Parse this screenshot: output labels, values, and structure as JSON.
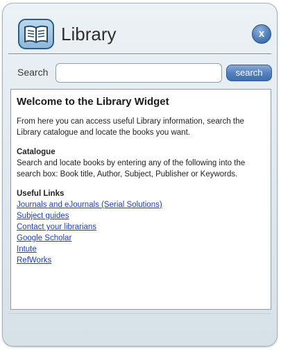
{
  "header": {
    "title": "Library",
    "app_icon": "open-book-icon",
    "close_label": "x"
  },
  "search": {
    "label": "Search",
    "value": "",
    "placeholder": "",
    "button_label": "search"
  },
  "content": {
    "heading": "Welcome to the Library Widget",
    "intro": "From here you can access useful Library information, search the Library catalogue and locate the books you want.",
    "catalogue": {
      "heading": "Catalogue",
      "text": "Search and locate books by entering any of the following into the search box: Book title, Author, Subject, Publisher or Keywords."
    },
    "useful_links": {
      "heading": "Useful Links",
      "links": [
        "Journals and eJournals (Serial Solutions)",
        "Subject guides",
        "Contact your librarians",
        "Google Scholar",
        "Intute",
        "RefWorks"
      ]
    }
  },
  "colors": {
    "accent": "#4f7fb9",
    "link": "#1a3fc9",
    "panel_background": "#dfe8ee"
  }
}
